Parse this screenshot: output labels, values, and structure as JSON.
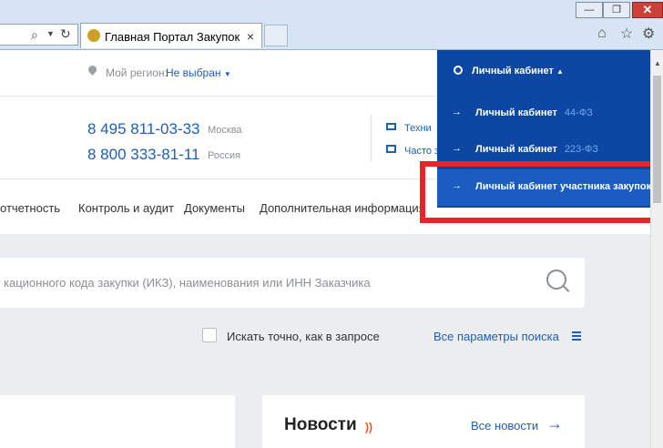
{
  "browser": {
    "tab_title": "Главная Портал Закупок",
    "tab_close": "×",
    "minimize": "—",
    "restore": "❐",
    "close": "✕",
    "icons": [
      "search-icon",
      "dropdown-icon",
      "refresh-icon",
      "home-icon",
      "star-icon",
      "gear-icon"
    ]
  },
  "header": {
    "region_label": "Мой регион:",
    "region_value": "Не выбран",
    "cabinet_label": "Личный кабинет"
  },
  "contacts": {
    "phone1": "8 495 811-03-33",
    "city1": "Москва",
    "phone2": "8 800 333-81-11",
    "city2": "Россия",
    "link1": "Техни",
    "link2": "Часто з"
  },
  "nav": {
    "items": [
      "отчетность",
      "Контроль и аудит",
      "Документы",
      "Дополнительная информация"
    ]
  },
  "dropdown": {
    "items": [
      {
        "label": "Личный кабинет",
        "law": "44-ФЗ"
      },
      {
        "label": "Личный кабинет",
        "law": "223-ФЗ"
      },
      {
        "label": "Личный кабинет участника закупок",
        "law": ""
      }
    ],
    "highlight_color": "#e8232a"
  },
  "search": {
    "placeholder": "кационного кода закупки (ИКЗ), наименования или ИНН Заказчика",
    "exact_label": "Искать точно, как в запросе",
    "all_params": "Все параметры поиска"
  },
  "news": {
    "title": "Новости",
    "all_link": "Все новости"
  },
  "colors": {
    "accent": "#1f5fb3",
    "dropdown_bg": "#0b47a3"
  }
}
